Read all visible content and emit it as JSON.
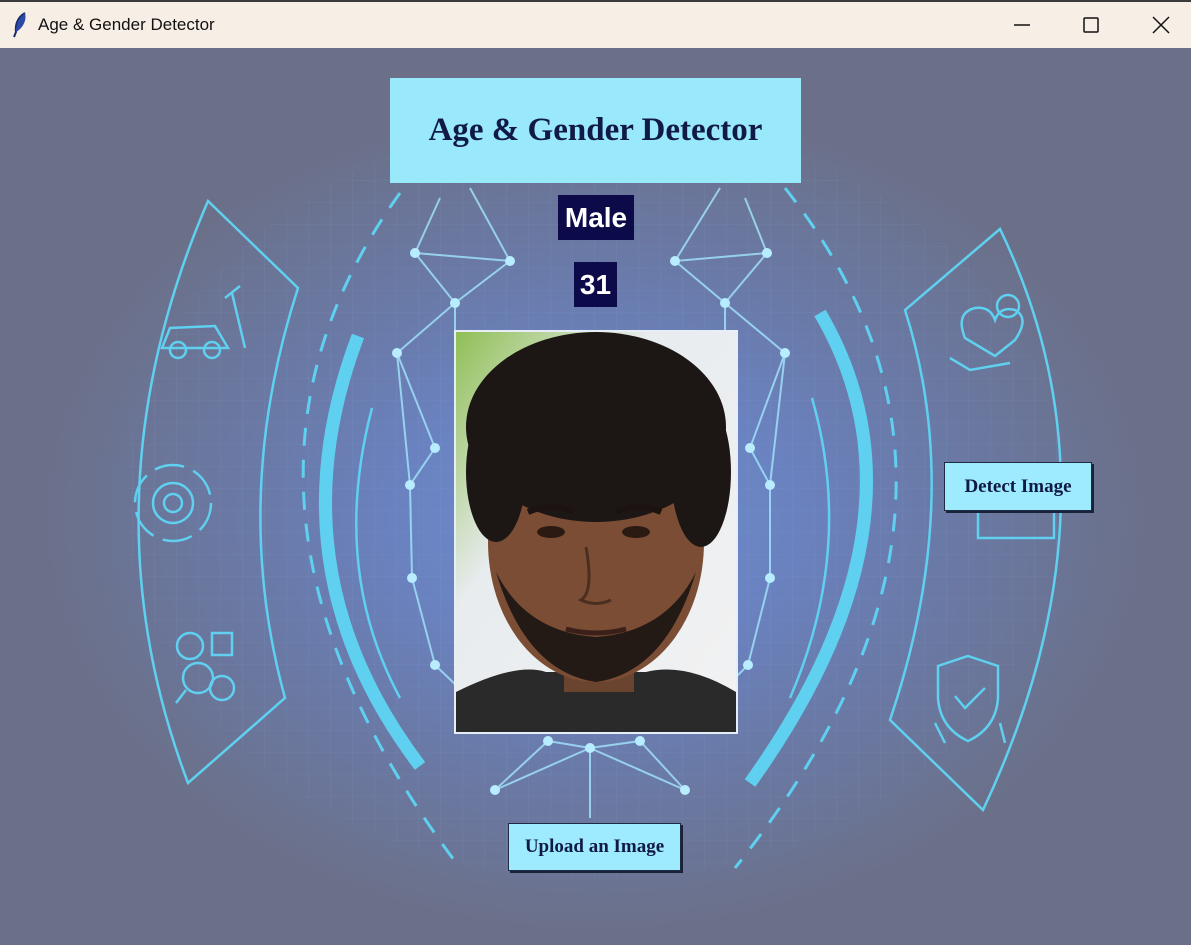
{
  "window": {
    "title": "Age & Gender Detector",
    "icon": "feather-icon",
    "controls": [
      "minimize-icon",
      "maximize-icon",
      "close-icon"
    ]
  },
  "header": {
    "title": "Age & Gender Detector"
  },
  "result": {
    "gender": "Male",
    "age": "31"
  },
  "buttons": {
    "detect": "Detect Image",
    "upload": "Upload an Image"
  },
  "background_icons": [
    "car-repair-icon",
    "gear-cycle-icon",
    "analytics-search-icon",
    "health-care-icon",
    "building-icon",
    "security-shield-icon"
  ],
  "colors": {
    "accent": "#99e9fb",
    "label_bg": "#0d0a4a",
    "text_dark": "#111a46",
    "line": "#5fd0f0"
  }
}
